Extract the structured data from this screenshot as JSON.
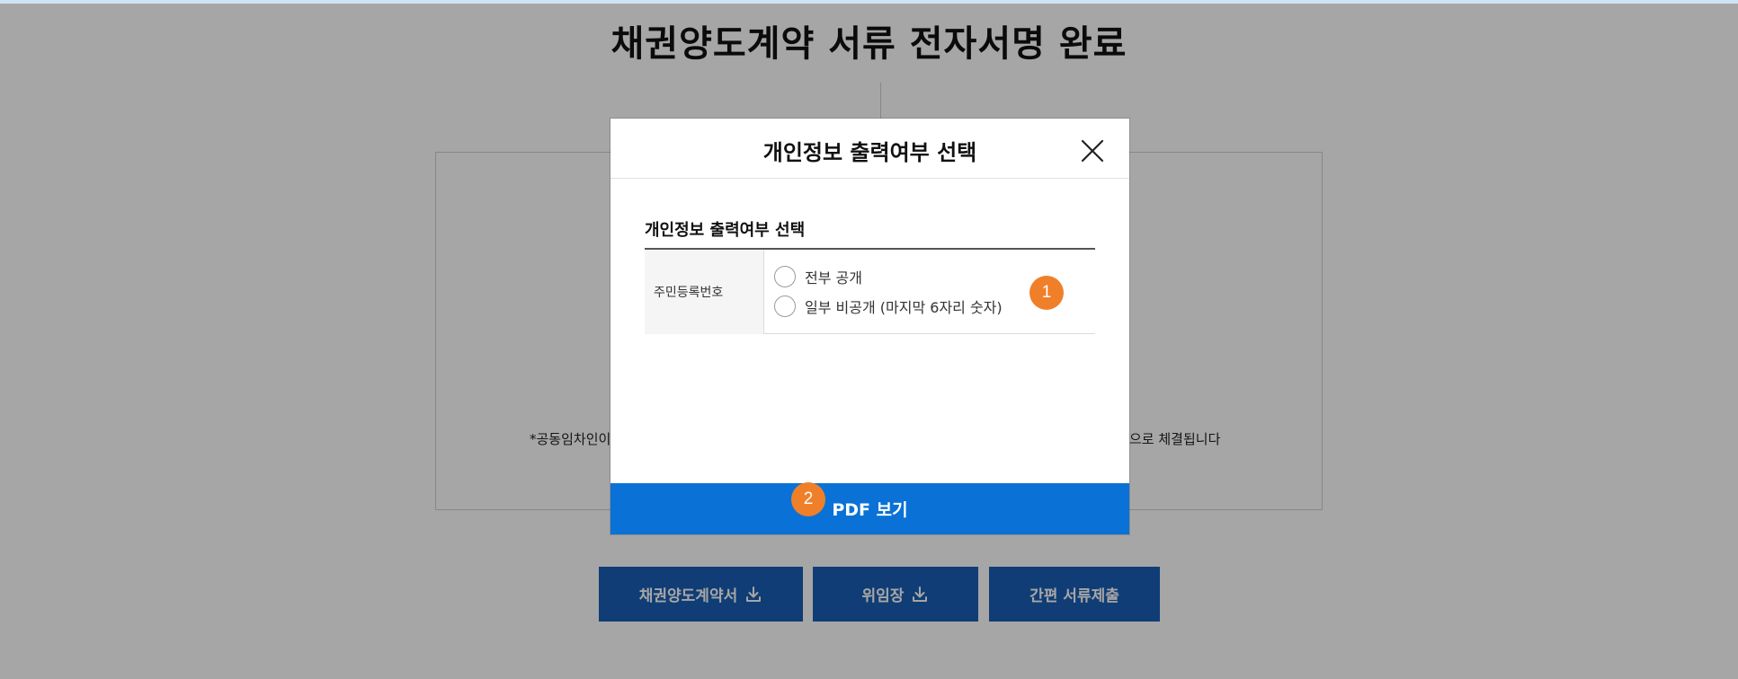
{
  "page": {
    "title": "채권양도계약 서류 전자서명 완료",
    "notice_left": "*공동임차인이",
    "notice_right": "으로 체결됩니다"
  },
  "buttons": {
    "contract_download": "채권양도계약서",
    "power_of_attorney_download": "위임장",
    "simple_submit": "간편 서류제출"
  },
  "modal": {
    "title": "개인정보 출력여부 선택",
    "section_title": "개인정보 출력여부 선택",
    "row_label": "주민등록번호",
    "options": [
      {
        "label": "전부 공개"
      },
      {
        "label": "일부 비공개 (마지막 6자리 숫자)"
      }
    ],
    "primary_button": "PDF 보기"
  },
  "annotations": {
    "badge_1": "1",
    "badge_2": "2"
  },
  "colors": {
    "primary_blue": "#0a72d6",
    "bottom_button_blue": "#1a5fb4",
    "badge_orange": "#f07f2a",
    "overlay": "rgba(0,0,0,0.35)"
  },
  "icons": {
    "close": "close-icon",
    "download": "download-icon"
  }
}
